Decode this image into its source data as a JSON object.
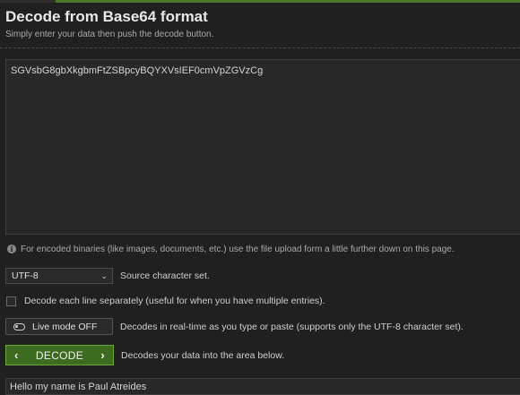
{
  "header": {
    "title": "Decode from Base64 format",
    "subtitle": "Simply enter your data then push the decode button."
  },
  "input": {
    "value": "SGVsbG8gbXkgbmFtZSBpcyBQYXVsIEF0cmVpZGVzCg"
  },
  "info": {
    "text": "For encoded binaries (like images, documents, etc.) use the file upload form a little further down on this page.",
    "icon": "info-icon"
  },
  "charset": {
    "selected": "UTF-8",
    "label": "Source character set."
  },
  "each_line": {
    "label": "Decode each line separately (useful for when you have multiple entries)."
  },
  "live_mode": {
    "button_label": "Live mode OFF",
    "label": "Decodes in real-time as you type or paste (supports only the UTF-8 character set)."
  },
  "decode": {
    "button_label": "DECODE",
    "label": "Decodes your data into the area below."
  },
  "output": {
    "value": "Hello my name is Paul Atreides"
  },
  "colors": {
    "accent": "#3d6b1f",
    "background": "#202020"
  }
}
